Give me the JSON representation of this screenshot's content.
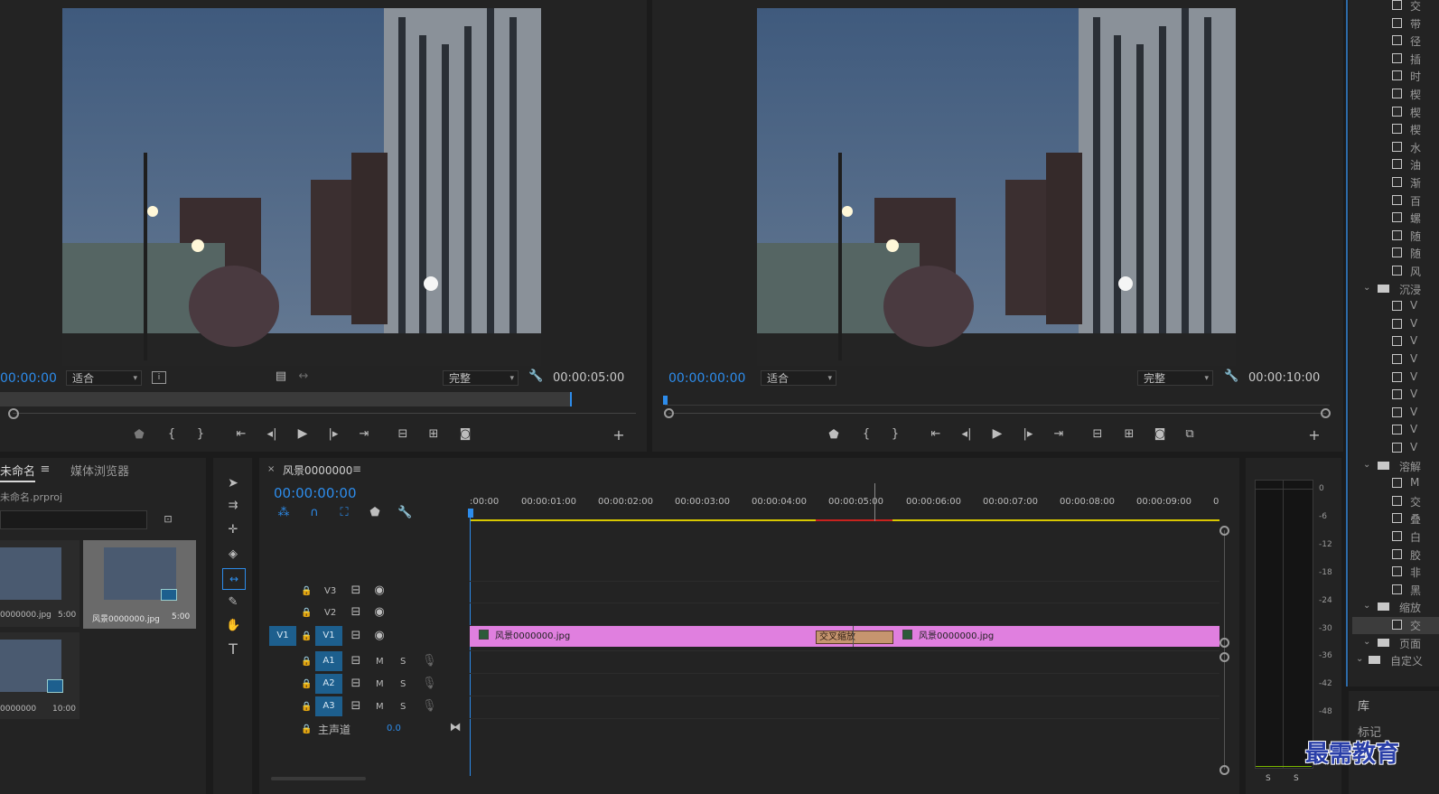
{
  "source_monitor": {
    "timecode_in": "00:00:00",
    "fit": "适合",
    "quality": "完整",
    "duration": "00:00:05:00"
  },
  "program_monitor": {
    "timecode": "00:00:00:00",
    "fit": "适合",
    "quality": "完整",
    "duration": "00:00:10:00"
  },
  "project": {
    "tab_project": "未命名",
    "tab_media": "媒体浏览器",
    "file_name": "未命名.prproj",
    "items": [
      {
        "name": "0000000.jpg",
        "duration": "5:00"
      },
      {
        "name": "风景0000000.jpg",
        "duration": "5:00"
      },
      {
        "name": "0000000",
        "duration": "10:00"
      }
    ]
  },
  "timeline": {
    "close": "×",
    "sequence_name": "风景0000000",
    "menu": "≡",
    "timecode": "00:00:00:00",
    "ruler": [
      ":00:00",
      "00:00:01:00",
      "00:00:02:00",
      "00:00:03:00",
      "00:00:04:00",
      "00:00:05:00",
      "00:00:06:00",
      "00:00:07:00",
      "00:00:08:00",
      "00:00:09:00",
      "0"
    ],
    "tracks_video": [
      "V3",
      "V2",
      "V1"
    ],
    "source_patch": "V1",
    "tracks_audio": [
      "A1",
      "A2",
      "A3"
    ],
    "mute": "M",
    "solo": "S",
    "master_label": "主声道",
    "master_value": "0.0",
    "clip1": "风景0000000.jpg",
    "clip2": "风景0000000.jpg",
    "transition": "交叉缩放"
  },
  "meter": {
    "labels": [
      "0",
      "-6",
      "-12",
      "-18",
      "-24",
      "-30",
      "-36",
      "-42",
      "-48"
    ],
    "solo_left": "S",
    "solo_right": "S"
  },
  "effects": {
    "rows_top": [
      "交",
      "带",
      "径",
      "插",
      "时",
      "楔",
      "楔",
      "楔",
      "水",
      "油",
      "渐",
      "百",
      "螺",
      "随",
      "随",
      "风"
    ],
    "folder_immersive": "沉浸",
    "rows_vr": [
      "V",
      "V",
      "V",
      "V",
      "V",
      "V",
      "V",
      "V",
      "V"
    ],
    "folder_dissolve": "溶解",
    "rows_dissolve": [
      "M",
      "交",
      "叠",
      "白",
      "胶",
      "非",
      "黑"
    ],
    "folder_zoom": "缩放",
    "row_zoom": "交",
    "folder_page": "页面",
    "folder_custom": "自定义",
    "libraries": "库",
    "markers": "标记"
  },
  "watermark": "最需教育"
}
